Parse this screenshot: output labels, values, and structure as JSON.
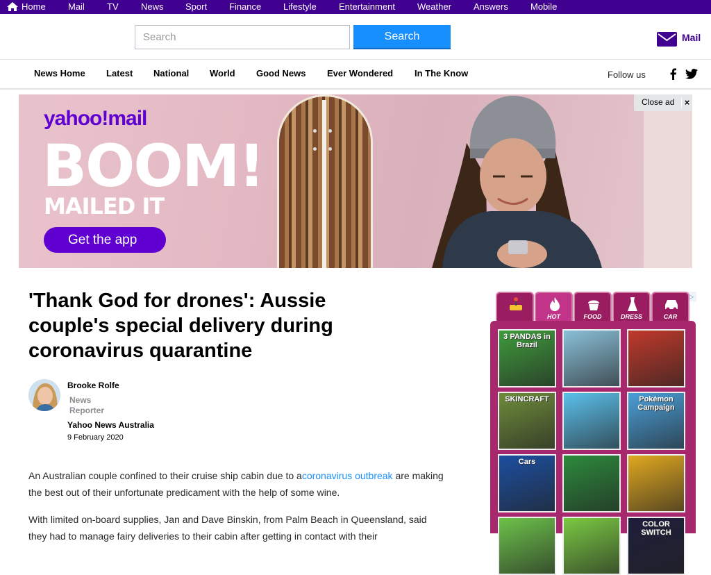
{
  "topbar": {
    "items": [
      "Home",
      "Mail",
      "TV",
      "News",
      "Sport",
      "Finance",
      "Lifestyle",
      "Entertainment",
      "Weather",
      "Answers",
      "Mobile"
    ]
  },
  "header": {
    "search_placeholder": "Search",
    "search_button": "Search",
    "mail_label": "Mail"
  },
  "nav": {
    "items": [
      "News Home",
      "Latest",
      "National",
      "World",
      "Good News",
      "Ever Wondered",
      "In The Know"
    ],
    "follow_us": "Follow us"
  },
  "ad": {
    "logo": "yahoo!mail",
    "headline": "BOOM!",
    "subhead": "MAILED IT",
    "cta": "Get the app",
    "close_label": "Close ad",
    "close_icon": "×"
  },
  "article": {
    "headline": "'Thank God for drones': Aussie couple's special delivery during coronavirus quarantine",
    "author": "Brooke Rolfe",
    "role": "News Reporter",
    "outlet": "Yahoo News Australia",
    "date": "9 February 2020",
    "para1_before": "An Australian couple confined to their cruise ship cabin due to a",
    "para1_link": "coronavirus outbreak",
    "para1_after": " are making the best out of their unfortunate predicament with the help of some wine.",
    "para2": "With limited on-board supplies, Jan and Dave Binskin, from Palm Beach in Queensland, said they had to manage fairy deliveries to their cabin after getting in contact with their"
  },
  "games": {
    "adchoice": "▷",
    "tabs": [
      {
        "label": "",
        "icon": "joystick-icon"
      },
      {
        "label": "HOT",
        "icon": "flame-icon"
      },
      {
        "label": "FOOD",
        "icon": "cupcake-icon"
      },
      {
        "label": "DRESS",
        "icon": "dress-icon"
      },
      {
        "label": "CAR",
        "icon": "car-icon"
      }
    ],
    "tiles": [
      {
        "title": "3 PANDAS in Brazil",
        "color": "#3f9b3c"
      },
      {
        "title": "",
        "color": "#8ac0d8"
      },
      {
        "title": "",
        "color": "#c0392b"
      },
      {
        "title": "SKINCRAFT",
        "color": "#6e8c3a"
      },
      {
        "title": "",
        "color": "#5bc0eb"
      },
      {
        "title": "Pokémon Campaign",
        "color": "#4a9fd8"
      },
      {
        "title": "Cars",
        "color": "#1c4fa0"
      },
      {
        "title": "",
        "color": "#2c8a3c"
      },
      {
        "title": "",
        "color": "#e0a820"
      },
      {
        "title": "",
        "color": "#6cc24a"
      },
      {
        "title": "",
        "color": "#7ac943"
      },
      {
        "title": "COLOR SWITCH",
        "color": "#1e1e3c"
      }
    ]
  }
}
